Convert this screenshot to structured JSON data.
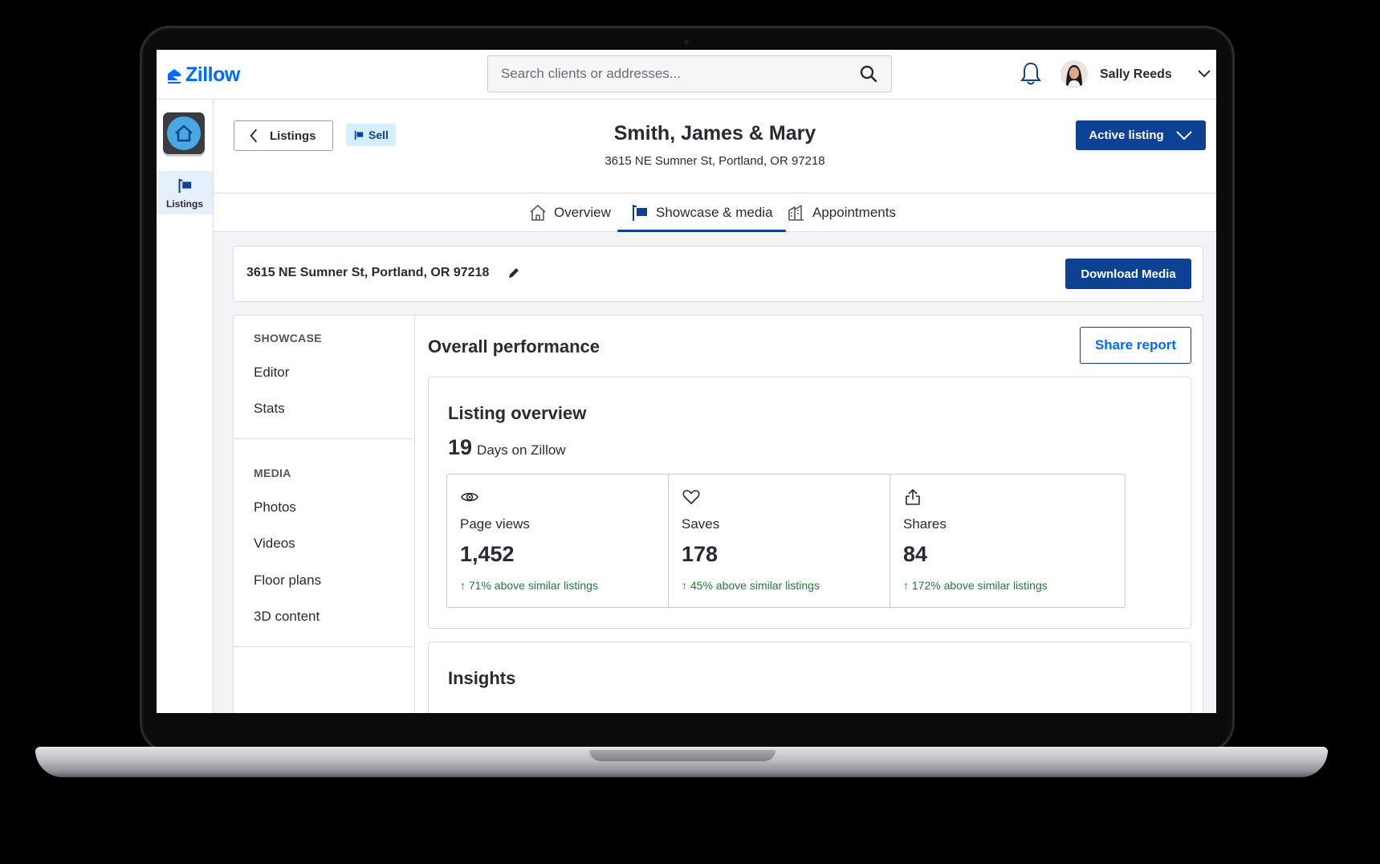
{
  "brand": {
    "name": "Zillow",
    "color": "#006aff"
  },
  "search": {
    "placeholder": "Search clients or addresses..."
  },
  "user": {
    "name": "Sally Reeds"
  },
  "rail": {
    "items": [
      {
        "label": "Listings",
        "icon": "flag-sign-icon",
        "active": true
      }
    ]
  },
  "header": {
    "back_label": "Listings",
    "badge_label": "Sell",
    "client_name": "Smith, James & Mary",
    "client_address": "3615 NE Sumner St, Portland, OR 97218",
    "status_label": "Active listing"
  },
  "tabs": [
    {
      "label": "Overview",
      "icon": "house-icon",
      "active": false
    },
    {
      "label": "Showcase & media",
      "icon": "flag-sign-icon",
      "active": true
    },
    {
      "label": "Appointments",
      "icon": "building-icon",
      "active": false
    }
  ],
  "address_bar": {
    "address": "3615 NE Sumner St, Portland, OR 97218",
    "download_label": "Download Media"
  },
  "side_menu": {
    "showcase_heading": "SHOWCASE",
    "showcase_items": [
      "Editor",
      "Stats"
    ],
    "media_heading": "MEDIA",
    "media_items": [
      "Photos",
      "Videos",
      "Floor plans",
      "3D content"
    ]
  },
  "performance": {
    "title": "Overall performance",
    "share_label": "Share report",
    "overview": {
      "title": "Listing overview",
      "days_value": "19",
      "days_label": "Days on Zillow",
      "stats": [
        {
          "icon": "eye-icon",
          "label": "Page views",
          "value": "1,452",
          "comparison": "71% above similar listings"
        },
        {
          "icon": "heart-icon",
          "label": "Saves",
          "value": "178",
          "comparison": "45% above similar listings"
        },
        {
          "icon": "share-icon",
          "label": "Shares",
          "value": "84",
          "comparison": "172% above similar listings"
        }
      ]
    },
    "insights_title": "Insights"
  },
  "colors": {
    "primary": "#0d4194",
    "accent": "#006aff",
    "positive": "#1b8035",
    "badge_bg": "#d6efff"
  }
}
